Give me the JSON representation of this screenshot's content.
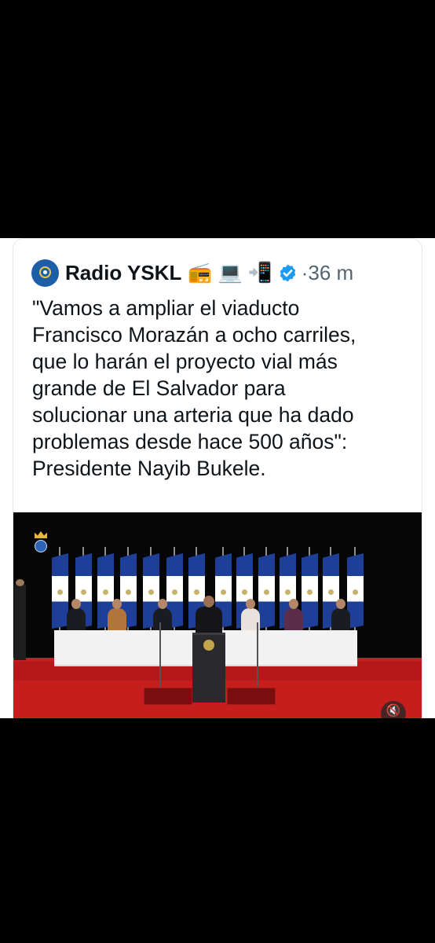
{
  "tweet": {
    "author": "Radio YSKL",
    "emojis": [
      "📻",
      "💻",
      "📲"
    ],
    "time_meta": "·36 m",
    "text": "\"Vamos a ampliar el viaducto\nFrancisco Morazán a ocho carriles,\nque lo harán el proyecto vial más\ngrande de El Salvador para\nsolucionar una arteria que ha dado\nproblemas desde hace 500 años\":\nPresidente Nayib Bukele.",
    "media": {
      "mute_icon": "speaker-muted-icon",
      "mute_glyph": "🔇"
    }
  },
  "colors": {
    "background": "#000000",
    "card": "#ffffff",
    "verified": "#1d9bf0",
    "meta_text": "#536471",
    "stage_red": "#c61d1d",
    "flag_blue": "#1e3f98"
  }
}
